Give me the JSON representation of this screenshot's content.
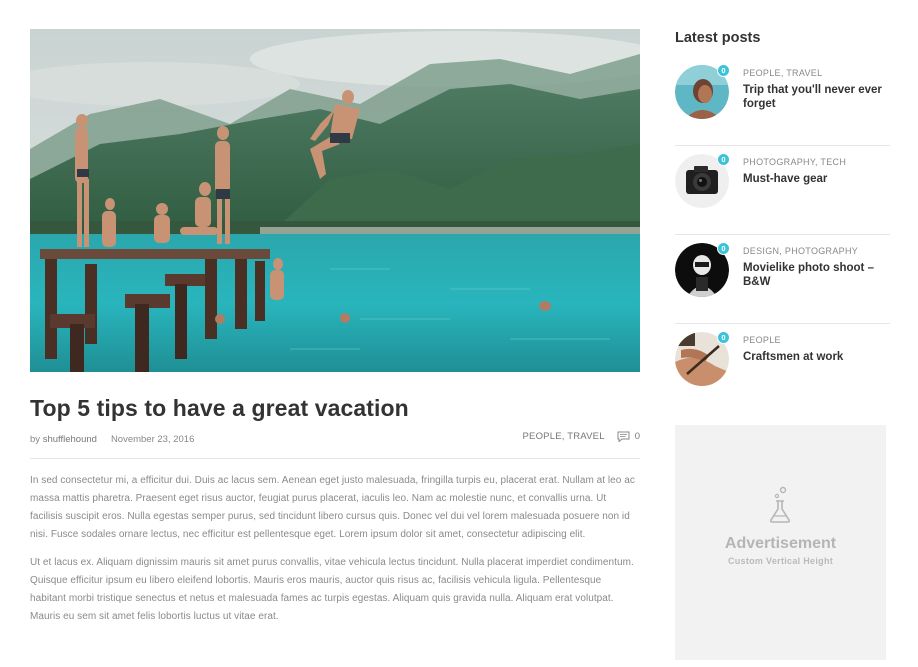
{
  "article": {
    "title": "Top 5 tips to have a great vacation",
    "by_prefix": "by",
    "author": "shufflehound",
    "date": "November 23, 2016",
    "categories": "PEOPLE, TRAVEL",
    "comment_count": "0",
    "paragraphs": [
      "In sed consectetur mi, a efficitur dui. Duis ac lacus sem. Aenean eget justo malesuada, fringilla turpis eu, placerat erat. Nullam at leo ac massa mattis pharetra. Praesent eget risus auctor, feugiat purus placerat, iaculis leo. Nam ac molestie nunc, et convallis urna. Ut facilisis suscipit eros. Nulla egestas semper purus, sed tincidunt libero cursus quis. Donec vel dui vel lorem malesuada posuere non id nisi. Fusce sodales ornare lectus, nec efficitur est pellentesque eget. Lorem ipsum dolor sit amet, consectetur adipiscing elit.",
      "Ut et lacus ex. Aliquam dignissim mauris sit amet purus convallis, vitae vehicula lectus tincidunt. Nulla placerat imperdiet condimentum. Quisque efficitur ipsum eu libero eleifend lobortis. Mauris eros mauris, auctor quis risus ac, facilisis vehicula ligula. Pellentesque habitant morbi tristique senectus et netus et malesuada fames ac turpis egestas. Aliquam quis gravida nulla. Aliquam erat volutpat. Mauris eu sem sit amet felis lobortis luctus ut vitae erat."
    ]
  },
  "sidebar": {
    "title": "Latest posts",
    "posts": [
      {
        "categories": "PEOPLE, TRAVEL",
        "title": "Trip that you'll never ever forget",
        "badge": "0",
        "thumb": "woman-portrait"
      },
      {
        "categories": "PHOTOGRAPHY, TECH",
        "title": "Must-have gear",
        "badge": "0",
        "thumb": "camera"
      },
      {
        "categories": "DESIGN, PHOTOGRAPHY",
        "title": "Movielike photo shoot – B&W",
        "badge": "0",
        "thumb": "bw-photo"
      },
      {
        "categories": "PEOPLE",
        "title": "Craftsmen at work",
        "badge": "0",
        "thumb": "hands-craft"
      }
    ]
  },
  "ad": {
    "title": "Advertisement",
    "subtitle": "Custom Vertical Height",
    "icon": "flask-icon"
  },
  "colors": {
    "accent": "#3cc3d9",
    "heading": "#333333",
    "muted": "#888888",
    "ad_bg": "#f2f2f2"
  }
}
